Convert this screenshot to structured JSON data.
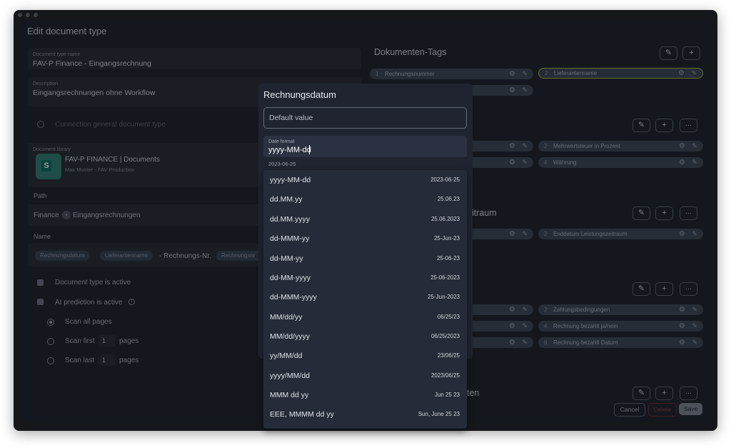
{
  "page": {
    "title": "Edit document type"
  },
  "fields": {
    "name_label": "Document type name",
    "name_value": "FAV-P Finance - Eingangsrechnung",
    "description_label": "Description",
    "description_value": "Eingangsrechnungen ohne Workflow",
    "connection_label": "Connection general document type",
    "library_label": "Document library",
    "library_name": "FAV-P FINANCE | Documents",
    "library_sub": "Max Muster - FAV Production",
    "library_icon_letter": "S"
  },
  "path": {
    "label": "Path",
    "segment1": "Finance",
    "segment2": "Eingangsrechnungen"
  },
  "name_section": {
    "label": "Name",
    "chips": [
      "Rechnungsdatum",
      "Lieferantenname",
      "Rechnungsnr"
    ],
    "separator": "- Rechnungs-Nr."
  },
  "options": {
    "active_label": "Document type is active",
    "ai_label": "AI prediction is active",
    "scan_all": "Scan all pages",
    "scan_first": "Scan first",
    "scan_first_value": "1",
    "scan_last": "Scan last",
    "scan_last_value": "1",
    "pages_label": "pages"
  },
  "right": {
    "tags_title": "Dokumenten-Tags",
    "tag_row1": [
      {
        "n": "1",
        "t": "Rechnungsnummer"
      },
      {
        "n": "2",
        "t": "Lieferantenname"
      }
    ],
    "section2_tags": [
      {
        "n": "2",
        "t": "Mehrwertsteuer in Prozent"
      },
      {
        "n": "4",
        "t": "Währung"
      }
    ],
    "section3_title_partial": "eitraum",
    "section3_tags": [
      {
        "n": "2",
        "t": "Enddatum Leistungszeitraum"
      }
    ],
    "section4_tags": [
      {
        "n": "2",
        "t": "Zahlungsbedingungen"
      },
      {
        "n": "4",
        "t": "Rechnung bezahlt ja/nein"
      },
      {
        "n": "6",
        "t": "Rechnung bezahlt Datum"
      }
    ],
    "section5_title_partial": "ten",
    "cancel": "Cancel",
    "delete": "Delete",
    "save": "Save"
  },
  "modal": {
    "title": "Rechnungsdatum",
    "default_placeholder": "Default value",
    "date_format_label": "Date format",
    "date_format_value": "yyyy-MM-dd",
    "helper": "2023-06-25",
    "formats": [
      {
        "fmt": "yyyy-MM-dd",
        "ex": "2023-06-25"
      },
      {
        "fmt": "dd.MM.yy",
        "ex": "25.06.23"
      },
      {
        "fmt": "dd.MM.yyyy",
        "ex": "25.06.2023"
      },
      {
        "fmt": "dd-MMM-yy",
        "ex": "25-Jun-23"
      },
      {
        "fmt": "dd-MM-yy",
        "ex": "25-06-23"
      },
      {
        "fmt": "dd-MM-yyyy",
        "ex": "25-06-2023"
      },
      {
        "fmt": "dd-MMM-yyyy",
        "ex": "25-Jun-2023"
      },
      {
        "fmt": "MM/dd/yy",
        "ex": "06/25/23"
      },
      {
        "fmt": "MM/dd/yyyy",
        "ex": "06/25/2023"
      },
      {
        "fmt": "yy/MM/dd",
        "ex": "23/06/25"
      },
      {
        "fmt": "yyyy/MM/dd",
        "ex": "2023/06/25"
      },
      {
        "fmt": "MMM dd yy",
        "ex": "Jun 25 23"
      },
      {
        "fmt": "EEE, MMMM dd yy",
        "ex": "Sun, June 25 23"
      }
    ]
  },
  "icons": {
    "edit": "pencil-icon",
    "add": "plus-icon",
    "more": "ellipsis-icon",
    "gear": "gear-icon",
    "info": "info-icon"
  }
}
